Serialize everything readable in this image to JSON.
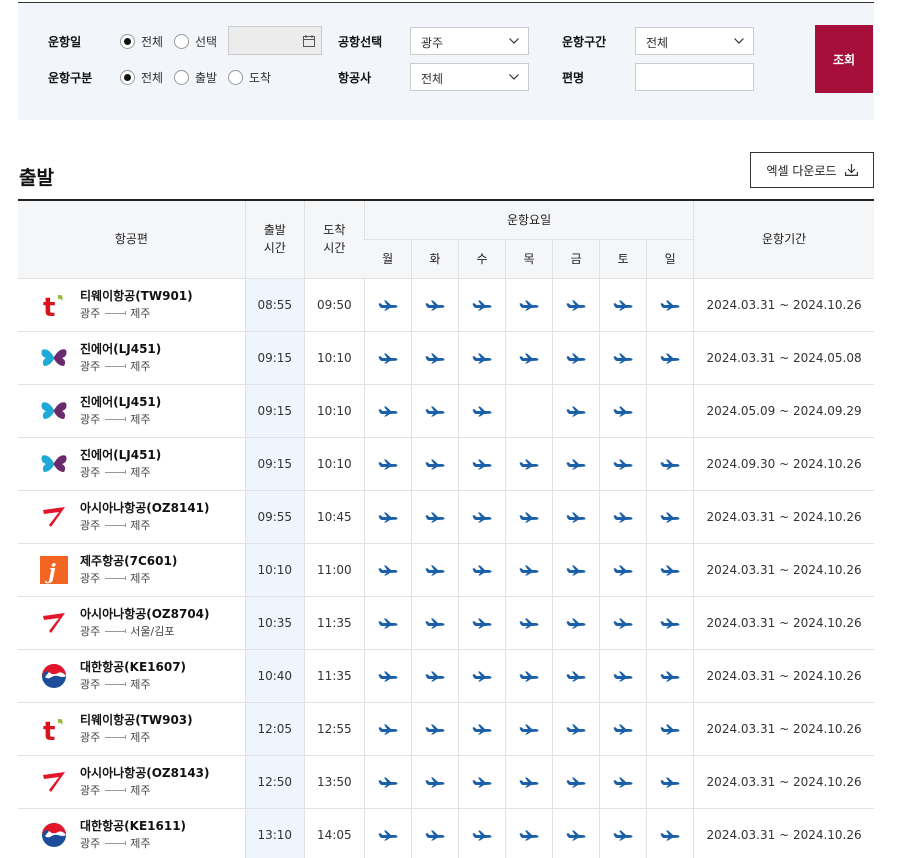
{
  "search": {
    "date_label": "운항일",
    "date_opt_all": "전체",
    "date_opt_select": "선택",
    "airport_label": "공항선택",
    "airport_value": "광주",
    "section_label": "운항구간",
    "section_value": "전체",
    "type_label": "운항구분",
    "type_opt_all": "전체",
    "type_opt_dep": "출발",
    "type_opt_arr": "도착",
    "airline_label": "항공사",
    "airline_value": "전체",
    "flightno_label": "편명",
    "flightno_value": "",
    "search_button": "조회"
  },
  "section": {
    "title": "출발",
    "excel_button": "엑셀 다운로드"
  },
  "table": {
    "col_flight": "항공편",
    "col_dep_l1": "출발",
    "col_dep_l2": "시간",
    "col_arr_l1": "도착",
    "col_arr_l2": "시간",
    "col_days": "운항요일",
    "col_period": "운항기간",
    "days": [
      "월",
      "화",
      "수",
      "목",
      "금",
      "토",
      "일"
    ],
    "rows": [
      {
        "airline": "tway",
        "name": "티웨이항공(TW901)",
        "from": "광주",
        "to": "제주",
        "dep": "08:55",
        "arr": "09:50",
        "days": [
          1,
          1,
          1,
          1,
          1,
          1,
          1
        ],
        "period": "2024.03.31 ~ 2024.10.26"
      },
      {
        "airline": "jinair",
        "name": "진에어(LJ451)",
        "from": "광주",
        "to": "제주",
        "dep": "09:15",
        "arr": "10:10",
        "days": [
          1,
          1,
          1,
          1,
          1,
          1,
          1
        ],
        "period": "2024.03.31 ~ 2024.05.08"
      },
      {
        "airline": "jinair",
        "name": "진에어(LJ451)",
        "from": "광주",
        "to": "제주",
        "dep": "09:15",
        "arr": "10:10",
        "days": [
          1,
          1,
          1,
          0,
          1,
          1,
          0
        ],
        "period": "2024.05.09 ~ 2024.09.29"
      },
      {
        "airline": "jinair",
        "name": "진에어(LJ451)",
        "from": "광주",
        "to": "제주",
        "dep": "09:15",
        "arr": "10:10",
        "days": [
          1,
          1,
          1,
          1,
          1,
          1,
          1
        ],
        "period": "2024.09.30 ~ 2024.10.26"
      },
      {
        "airline": "asiana",
        "name": "아시아나항공(OZ8141)",
        "from": "광주",
        "to": "제주",
        "dep": "09:55",
        "arr": "10:45",
        "days": [
          1,
          1,
          1,
          1,
          1,
          1,
          1
        ],
        "period": "2024.03.31 ~ 2024.10.26"
      },
      {
        "airline": "jeju",
        "name": "제주항공(7C601)",
        "from": "광주",
        "to": "제주",
        "dep": "10:10",
        "arr": "11:00",
        "days": [
          1,
          1,
          1,
          1,
          1,
          1,
          1
        ],
        "period": "2024.03.31 ~ 2024.10.26"
      },
      {
        "airline": "asiana",
        "name": "아시아나항공(OZ8704)",
        "from": "광주",
        "to": "서울/김포",
        "dep": "10:35",
        "arr": "11:35",
        "days": [
          1,
          1,
          1,
          1,
          1,
          1,
          1
        ],
        "period": "2024.03.31 ~ 2024.10.26"
      },
      {
        "airline": "korean",
        "name": "대한항공(KE1607)",
        "from": "광주",
        "to": "제주",
        "dep": "10:40",
        "arr": "11:35",
        "days": [
          1,
          1,
          1,
          1,
          1,
          1,
          1
        ],
        "period": "2024.03.31 ~ 2024.10.26"
      },
      {
        "airline": "tway",
        "name": "티웨이항공(TW903)",
        "from": "광주",
        "to": "제주",
        "dep": "12:05",
        "arr": "12:55",
        "days": [
          1,
          1,
          1,
          1,
          1,
          1,
          1
        ],
        "period": "2024.03.31 ~ 2024.10.26"
      },
      {
        "airline": "asiana",
        "name": "아시아나항공(OZ8143)",
        "from": "광주",
        "to": "제주",
        "dep": "12:50",
        "arr": "13:50",
        "days": [
          1,
          1,
          1,
          1,
          1,
          1,
          1
        ],
        "period": "2024.03.31 ~ 2024.10.26"
      },
      {
        "airline": "korean",
        "name": "대한항공(KE1611)",
        "from": "광주",
        "to": "제주",
        "dep": "13:10",
        "arr": "14:05",
        "days": [
          1,
          1,
          1,
          1,
          1,
          1,
          1
        ],
        "period": "2024.03.31 ~ 2024.10.26"
      }
    ]
  },
  "colors": {
    "accent": "#a50f3a",
    "plane": "#1a5fa8",
    "panel_bg": "#f2f5f9",
    "dep_col_bg": "#eef5fd"
  }
}
